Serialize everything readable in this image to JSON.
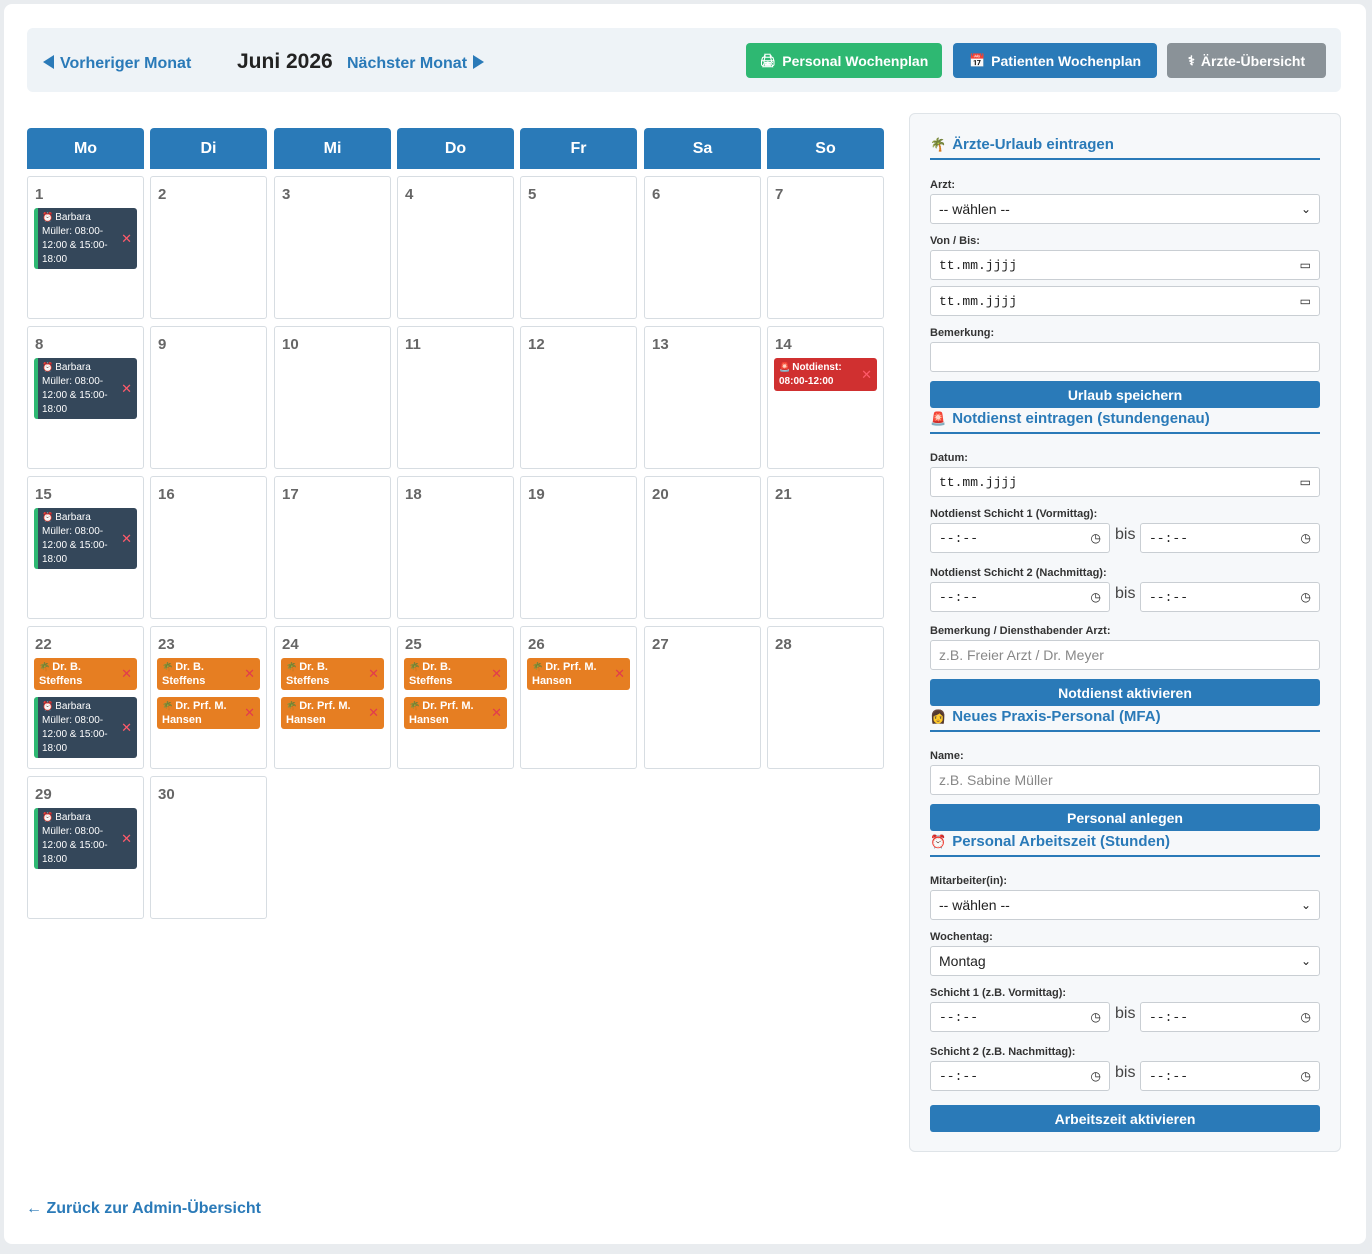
{
  "header": {
    "prev_label": "Vorheriger Monat",
    "month": "Juni 2026",
    "next_label": "Nächster Monat",
    "btn_personal": "Personal Wochenplan",
    "btn_patienten": "Patienten Wochenplan",
    "btn_aerzte": "Ärzte-Übersicht",
    "colors": {
      "green": "#2eb872",
      "blue": "#2a7ab8",
      "gray": "#8a9298"
    }
  },
  "calendar": {
    "weekdays": [
      "Mo",
      "Di",
      "Mi",
      "Do",
      "Fr",
      "Sa",
      "So"
    ],
    "days": [
      "1",
      "2",
      "3",
      "4",
      "5",
      "6",
      "7",
      "8",
      "9",
      "10",
      "11",
      "12",
      "13",
      "14",
      "15",
      "16",
      "17",
      "18",
      "19",
      "20",
      "21",
      "22",
      "23",
      "24",
      "25",
      "26",
      "27",
      "28",
      "29",
      "30"
    ],
    "shift_text": "Barbara Müller: 08:00-12:00 & 15:00-18:00",
    "emergency_text": "Notdienst: 08:00-12:00",
    "vacation_steffens": "Dr. B. Steffens",
    "vacation_hansen": "Dr. Prf. M. Hansen",
    "delete_glyph": "✕"
  },
  "sidebar": {
    "vacation": {
      "title": "Ärzte-Urlaub eintragen",
      "arzt_label": "Arzt:",
      "arzt_value": "-- wählen --",
      "vonbis_label": "Von / Bis:",
      "date_placeholder": "tt.mm.jjjj",
      "bemerkung_label": "Bemerkung:",
      "save_button": "Urlaub speichern"
    },
    "emergency": {
      "title": "Notdienst eintragen (stundengenau)",
      "datum_label": "Datum:",
      "date_placeholder": "tt.mm.jjjj",
      "shift1_label": "Notdienst Schicht 1 (Vormittag):",
      "shift2_label": "Notdienst Schicht 2 (Nachmittag):",
      "time_placeholder": "--:--",
      "bis": "bis",
      "remark_label": "Bemerkung / Diensthabender Arzt:",
      "remark_placeholder": "z.B. Freier Arzt / Dr. Meyer",
      "activate_button": "Notdienst aktivieren"
    },
    "staff": {
      "title": "Neues Praxis-Personal (MFA)",
      "name_label": "Name:",
      "name_placeholder": "z.B. Sabine Müller",
      "create_button": "Personal anlegen"
    },
    "worktime": {
      "title": "Personal Arbeitszeit (Stunden)",
      "employee_label": "Mitarbeiter(in):",
      "employee_value": "-- wählen --",
      "weekday_label": "Wochentag:",
      "weekday_value": "Montag",
      "shift1_label": "Schicht 1 (z.B. Vormittag):",
      "shift2_label": "Schicht 2 (z.B. Nachmittag):",
      "time_placeholder": "--:--",
      "bis": "bis",
      "activate_button": "Arbeitszeit aktivieren"
    }
  },
  "footer": {
    "back_label": "← Zurück zur Admin-Übersicht"
  }
}
